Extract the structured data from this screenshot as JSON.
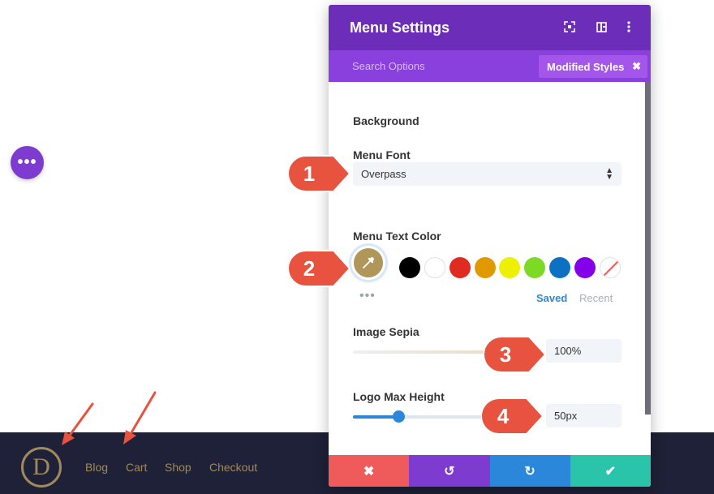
{
  "float_button": {
    "icon": "more-dots-icon",
    "label": "•••"
  },
  "footer": {
    "logo_letter": "D",
    "nav": [
      "Blog",
      "Cart",
      "Shop",
      "Checkout"
    ]
  },
  "panel": {
    "title": "Menu Settings",
    "search_label": "Search Options",
    "modified_label": "Modified Styles",
    "modified_close": "✖",
    "section_background": "Background",
    "menu_font_label": "Menu Font",
    "menu_font_value": "Overpass",
    "menu_text_color_label": "Menu Text Color",
    "current_color": "#b1965a",
    "swatches": [
      "#000000",
      "#ffffff",
      "#e02b20",
      "#e09900",
      "#edf000",
      "#7cda24",
      "#0c71c3",
      "#8300e9",
      "transparent"
    ],
    "more_dots": "•••",
    "tab_saved": "Saved",
    "tab_recent": "Recent",
    "image_sepia_label": "Image Sepia",
    "image_sepia_value": "100%",
    "image_sepia_level": 1.0,
    "logo_max_height_label": "Logo Max Height",
    "logo_max_height_value": "50px",
    "footer_buttons": [
      {
        "icon": "close-icon",
        "glyph": "✖",
        "color": "#ef5a5a"
      },
      {
        "icon": "undo-icon",
        "glyph": "↺",
        "color": "#7e3bd0"
      },
      {
        "icon": "redo-icon",
        "glyph": "↻",
        "color": "#2b87da"
      },
      {
        "icon": "checkmark-icon",
        "glyph": "✔",
        "color": "#29c4a9"
      }
    ]
  },
  "callouts": [
    "1",
    "2",
    "3",
    "4"
  ],
  "colors": {
    "accent": "#6c2eb9",
    "callout": "#e8533f",
    "footer_bg": "#1e2137",
    "logo_gold": "#a08a5c"
  }
}
